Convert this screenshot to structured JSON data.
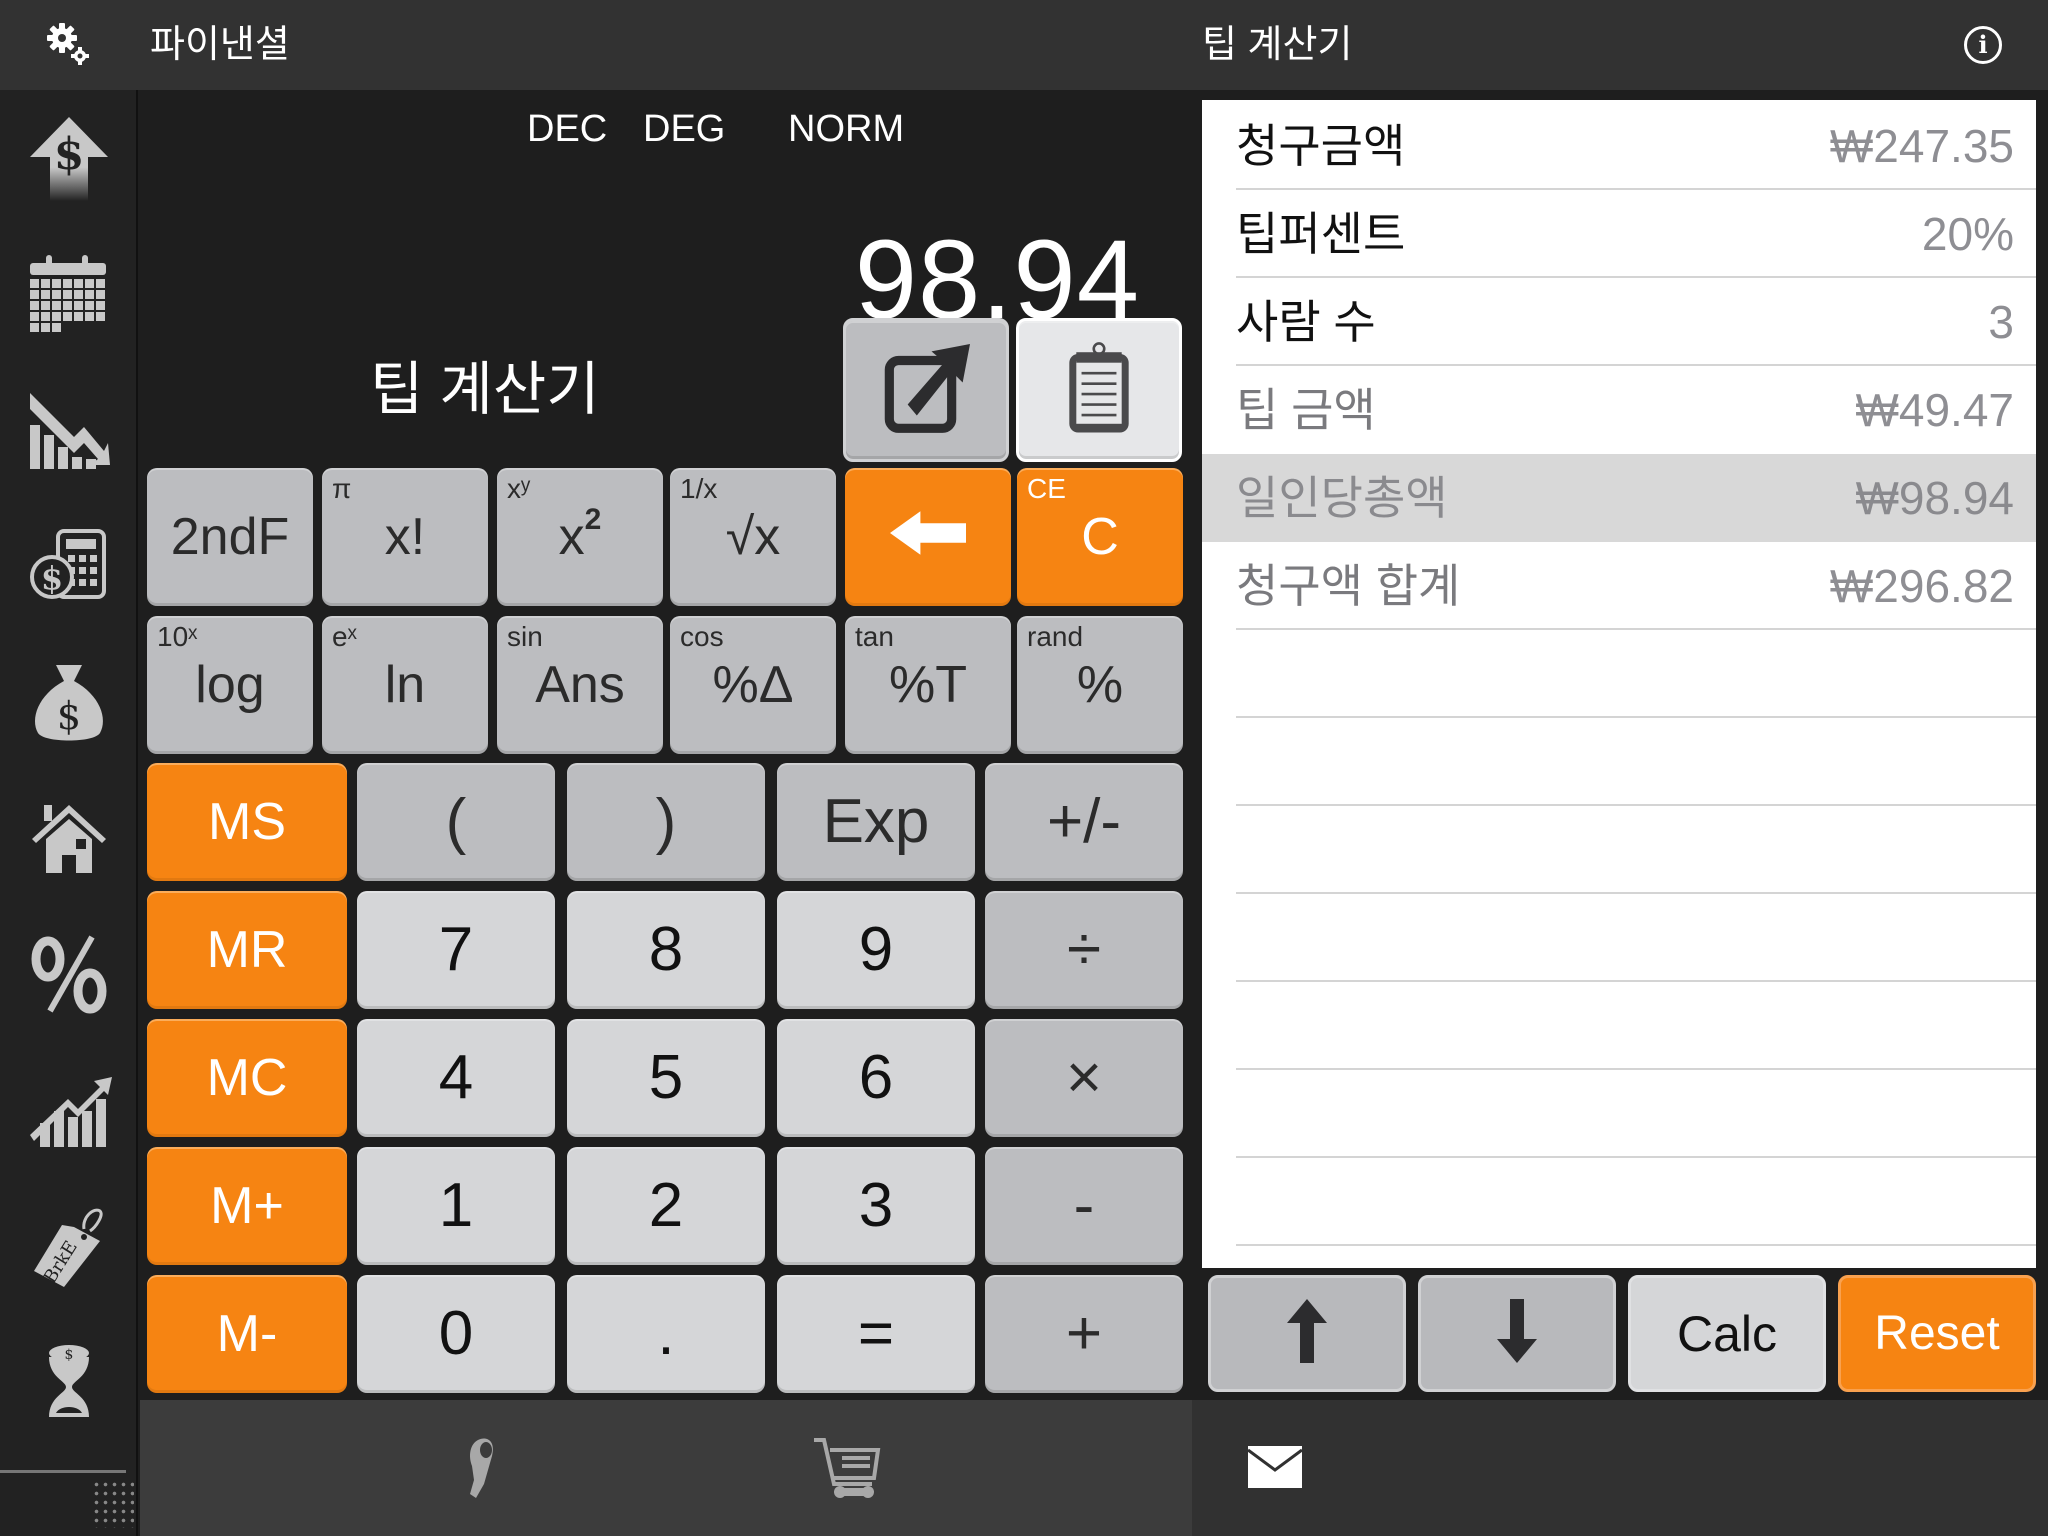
{
  "header": {
    "app_title": "파이낸셜",
    "page_title": "팁 계산기",
    "settings_icon": "gear-icon",
    "info_icon": "info-icon",
    "info_glyph": "i"
  },
  "sidebar": {
    "items": [
      {
        "name": "income-up-dollar",
        "icon": "dollar-up-arrow-icon"
      },
      {
        "name": "calendar",
        "icon": "calendar-icon"
      },
      {
        "name": "depreciation",
        "icon": "declining-chart-icon"
      },
      {
        "name": "loan-calculator",
        "icon": "dollar-calculator-icon"
      },
      {
        "name": "savings",
        "icon": "money-bag-icon"
      },
      {
        "name": "mortgage",
        "icon": "house-icon"
      },
      {
        "name": "interest-rate",
        "icon": "percent-cycle-icon"
      },
      {
        "name": "investment",
        "icon": "growth-chart-icon"
      },
      {
        "name": "break-even",
        "icon": "price-tag-icon",
        "tag_text": "BrkE"
      },
      {
        "name": "time-value",
        "icon": "hourglass-dollar-icon"
      }
    ]
  },
  "calculator": {
    "modes": [
      "DEC",
      "DEG",
      "NORM"
    ],
    "display": "98.94",
    "title": "팁 계산기",
    "action_buttons": [
      {
        "name": "export",
        "icon": "export-icon"
      },
      {
        "name": "paste",
        "icon": "clipboard-icon"
      }
    ],
    "sci_keys": [
      {
        "main": "2ndF",
        "sup": "",
        "style": "gray"
      },
      {
        "main": "x!",
        "sup": "π",
        "style": "gray"
      },
      {
        "main": "x",
        "main_sup": "2",
        "sup": "xʸ",
        "style": "gray"
      },
      {
        "main": "√x",
        "sup": "1/x",
        "style": "gray"
      },
      {
        "main": "⬅",
        "sup": "",
        "style": "orange",
        "icon": "backspace-arrow-icon"
      },
      {
        "main": "C",
        "sup": "CE",
        "style": "orange"
      },
      {
        "main": "log",
        "sup": "10ˣ",
        "style": "gray"
      },
      {
        "main": "ln",
        "sup": "eˣ",
        "style": "gray"
      },
      {
        "main": "Ans",
        "sup": "sin",
        "style": "gray"
      },
      {
        "main": "%Δ",
        "sup": "cos",
        "style": "gray"
      },
      {
        "main": "%T",
        "sup": "tan",
        "style": "gray"
      },
      {
        "main": "%",
        "sup": "rand",
        "style": "gray"
      }
    ],
    "pad_keys": [
      {
        "main": "MS",
        "style": "orange"
      },
      {
        "main": "(",
        "style": "gray"
      },
      {
        "main": ")",
        "style": "gray"
      },
      {
        "main": "Exp",
        "style": "gray"
      },
      {
        "main": "+/-",
        "style": "gray"
      },
      {
        "main": "MR",
        "style": "orange"
      },
      {
        "main": "7",
        "style": "light"
      },
      {
        "main": "8",
        "style": "light"
      },
      {
        "main": "9",
        "style": "light"
      },
      {
        "main": "÷",
        "style": "gray"
      },
      {
        "main": "MC",
        "style": "orange"
      },
      {
        "main": "4",
        "style": "light"
      },
      {
        "main": "5",
        "style": "light"
      },
      {
        "main": "6",
        "style": "light"
      },
      {
        "main": "×",
        "style": "gray"
      },
      {
        "main": "M+",
        "style": "orange"
      },
      {
        "main": "1",
        "style": "light"
      },
      {
        "main": "2",
        "style": "light"
      },
      {
        "main": "3",
        "style": "light"
      },
      {
        "main": "-",
        "style": "gray"
      },
      {
        "main": "M-",
        "style": "orange"
      },
      {
        "main": "0",
        "style": "light"
      },
      {
        "main": ".",
        "style": "light"
      },
      {
        "main": "=",
        "style": "light"
      },
      {
        "main": "+",
        "style": "gray"
      }
    ]
  },
  "tip_list": {
    "rows": [
      {
        "label": "청구금액",
        "value": "₩247.35"
      },
      {
        "label": "팁퍼센트",
        "value": "20%"
      },
      {
        "label": "사람 수",
        "value": "3"
      },
      {
        "label": "팁 금액",
        "value": "₩49.47"
      },
      {
        "label": "일인당총액",
        "value": "₩98.94",
        "selected": true
      },
      {
        "label": "청구액 합계",
        "value": "₩296.82"
      }
    ],
    "buttons": {
      "up_icon": "arrow-up-icon",
      "down_icon": "arrow-down-icon",
      "calc_label": "Calc",
      "reset_label": "Reset"
    }
  },
  "toolbar": {
    "tape_icon": "tape-icon",
    "cart_icon": "shopping-cart-icon",
    "mail_icon": "mail-icon"
  },
  "colors": {
    "accent_orange": "#f68412",
    "key_gray": "#bcbdc0",
    "key_light": "#d5d6d8",
    "highlight_row": "#d8d8d8"
  }
}
